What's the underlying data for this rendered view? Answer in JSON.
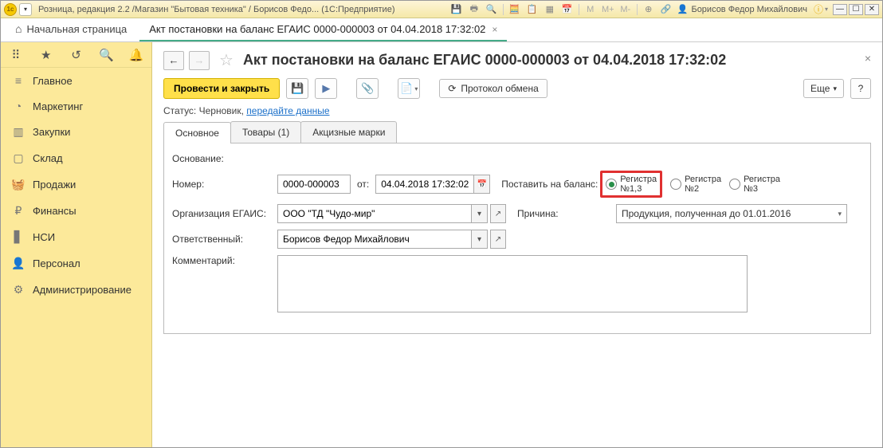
{
  "titlebar": {
    "text": "Розница, редакция 2.2 /Магазин \"Бытовая техника\" / Борисов Федо... (1С:Предприятие)",
    "user": "Борисов Федор Михайлович"
  },
  "tabs": {
    "home": "Начальная страница",
    "doc": "Акт постановки на баланс ЕГАИС 0000-000003 от 04.04.2018 17:32:02"
  },
  "sidebar": {
    "items": [
      {
        "icon": "≡",
        "label": "Главное"
      },
      {
        "icon": "◔",
        "label": "Маркетинг"
      },
      {
        "icon": "▥",
        "label": "Закупки"
      },
      {
        "icon": "▢",
        "label": "Склад"
      },
      {
        "icon": "🧺",
        "label": "Продажи"
      },
      {
        "icon": "₽",
        "label": "Финансы"
      },
      {
        "icon": "▋",
        "label": "НСИ"
      },
      {
        "icon": "👤",
        "label": "Персонал"
      },
      {
        "icon": "⚙",
        "label": "Администрирование"
      }
    ]
  },
  "page": {
    "title": "Акт постановки на баланс ЕГАИС 0000-000003 от 04.04.2018 17:32:02"
  },
  "toolbar": {
    "submit": "Провести и закрыть",
    "protocol": "Протокол обмена",
    "more": "Еще"
  },
  "status": {
    "label": "Статус:",
    "value": "Черновик,",
    "link": "передайте данные"
  },
  "inner_tabs": [
    "Основное",
    "Товары (1)",
    "Акцизные марки"
  ],
  "form": {
    "basis_label": "Основание:",
    "number_label": "Номер:",
    "number_value": "0000-000003",
    "from_label": "от:",
    "date_value": "04.04.2018 17:32:02",
    "put_on_balance_label": "Поставить на баланс:",
    "radios": [
      "Регистра\n№1,3",
      "Регистра\n№2",
      "Регистра\n№3"
    ],
    "org_label": "Организация ЕГАИС:",
    "org_value": "ООО \"ТД \"Чудо-мир\"",
    "reason_label": "Причина:",
    "reason_value": "Продукция, полученная до 01.01.2016",
    "resp_label": "Ответственный:",
    "resp_value": "Борисов Федор Михайлович",
    "comment_label": "Комментарий:"
  }
}
